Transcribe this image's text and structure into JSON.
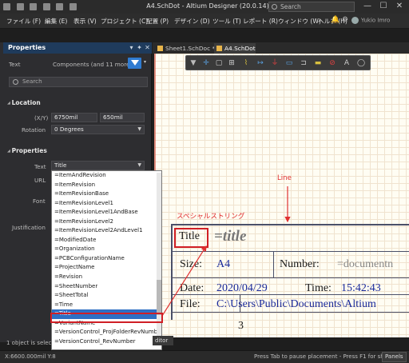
{
  "window": {
    "title": "A4.SchDot - Altium Designer (20.0.14)",
    "search_placeholder": "Search",
    "minimize": "—",
    "maximize": "☐",
    "close": "✕"
  },
  "menu": [
    "ファイル (F)",
    "編集 (E)",
    "表示 (V)",
    "プロジェクト (C)",
    "配置 (P)",
    "デザイン (D)",
    "ツール (T)",
    "レポート (R)",
    "ウィンドウ (W)",
    "ヘルプ (H)"
  ],
  "user": {
    "name": "Yukio Imro"
  },
  "properties_panel": {
    "header": "Properties",
    "object_type": "Text",
    "selection": "Components (and 11 more)",
    "search_placeholder": "Search",
    "location": {
      "section": "Location",
      "xy_label": "(X/Y)",
      "x": "6750mil",
      "y": "650mil",
      "rotation_label": "Rotation",
      "rotation": "0 Degrees"
    },
    "properties": {
      "section": "Properties",
      "text_label": "Text",
      "text_value": "Title",
      "url_label": "URL",
      "font_label": "Font",
      "justification_label": "Justification"
    },
    "status_text": "1 object is select"
  },
  "dropdown_options": [
    "=ItemAndRevision",
    "=ItemRevision",
    "=ItemRevisionBase",
    "=ItemRevisionLevel1",
    "=ItemRevisionLevel1AndBase",
    "=ItemRevisionLevel2",
    "=ItemRevisionLevel2AndLevel1",
    "=ModifiedDate",
    "=Organization",
    "=PCBConfigurationName",
    "=ProjectName",
    "=Revision",
    "=SheetNumber",
    "=SheetTotal",
    "=Time",
    "=Title",
    "=VariantName",
    "=VersionControl_ProjFolderRevNumber",
    "=VersionControl_RevNumber"
  ],
  "dropdown_selected": "=Title",
  "tabs": [
    "Sheet1.SchDoc *",
    "A4.SchDot"
  ],
  "annotations": {
    "line": "Line",
    "special_string": "スペシャルストリング"
  },
  "title_block": {
    "title_label": "Title",
    "title_value": "=title",
    "size_label": "Size:",
    "size_value": "A4",
    "number_label": "Number:",
    "number_value": "=documentn",
    "date_label": "Date:",
    "date_value": "2020/04/29",
    "time_label": "Time:",
    "time_value": "15:42:43",
    "file_label": "File:",
    "file_value": "C:\\Users\\Public\\Documents\\Altium",
    "sheet_num": "3"
  },
  "status_bar": {
    "coords": "X:6600.000mil Y:8",
    "hint": "Press Tab to pause placement - Press F1 for sho",
    "panels": "Panels",
    "editor_tab": "ditor"
  },
  "colors": {
    "accent": "#2e6fc4",
    "annotation": "#e03030",
    "title_block_text": "#1a2a9a"
  }
}
